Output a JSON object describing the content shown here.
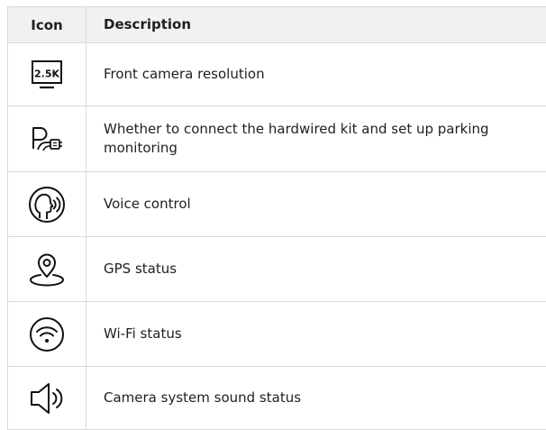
{
  "table": {
    "header": {
      "icon": "Icon",
      "description": "Description"
    },
    "rows": [
      {
        "icon_name": "resolution-2.5k-icon",
        "icon_text": "2.5K",
        "description": "Front camera resolution"
      },
      {
        "icon_name": "parking-hardwire-icon",
        "description": "Whether to connect the hardwired kit and set up parking monitoring"
      },
      {
        "icon_name": "voice-control-icon",
        "description": "Voice control"
      },
      {
        "icon_name": "gps-status-icon",
        "description": "GPS status"
      },
      {
        "icon_name": "wifi-status-icon",
        "description": "Wi-Fi status"
      },
      {
        "icon_name": "speaker-sound-icon",
        "description": "Camera system sound status"
      }
    ]
  },
  "colors": {
    "header_bg": "#f1f1f1",
    "border": "#d9d9d9",
    "text": "#1f1f1f"
  }
}
